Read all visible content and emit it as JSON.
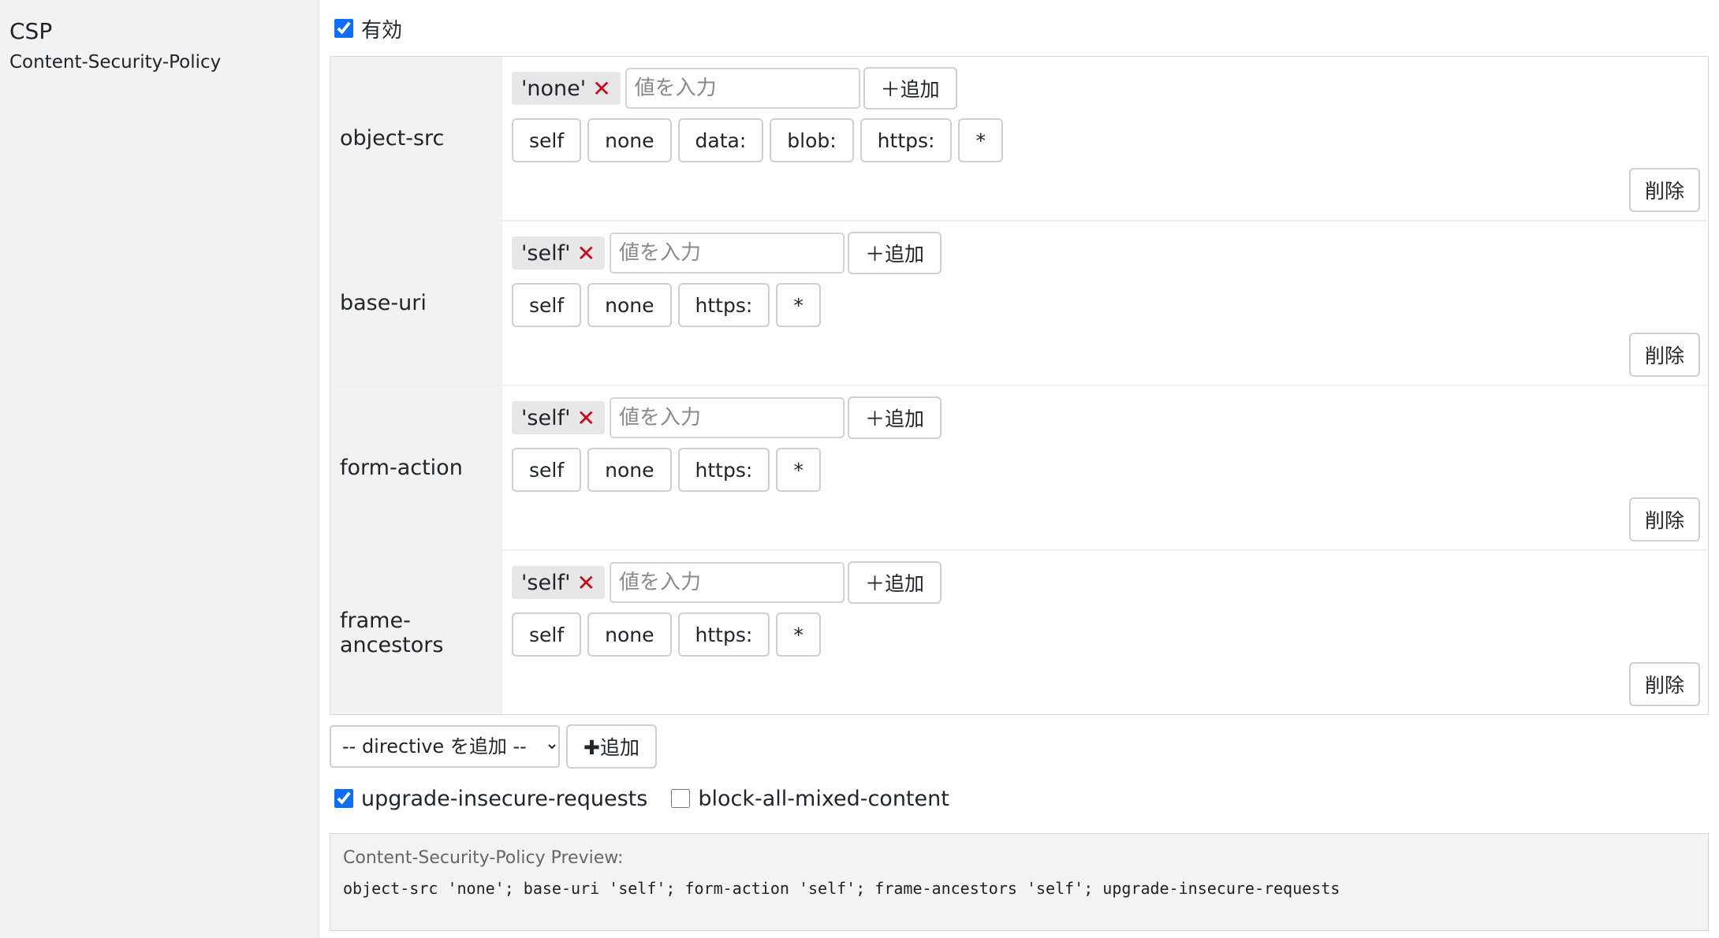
{
  "section": {
    "title": "CSP",
    "subtitle": "Content-Security-Policy"
  },
  "enabled": {
    "label": "有効",
    "checked": true
  },
  "input_placeholder": "値を入力",
  "add_label": "＋追加",
  "delete_label": "削除",
  "directives": [
    {
      "name": "object-src",
      "chip": "'none'",
      "presets": [
        "self",
        "none",
        "data:",
        "blob:",
        "https:",
        "*"
      ]
    },
    {
      "name": "base-uri",
      "chip": "'self'",
      "presets": [
        "self",
        "none",
        "https:",
        "*"
      ]
    },
    {
      "name": "form-action",
      "chip": "'self'",
      "presets": [
        "self",
        "none",
        "https:",
        "*"
      ]
    },
    {
      "name": "frame-ancestors",
      "chip": "'self'",
      "presets": [
        "self",
        "none",
        "https:",
        "*"
      ]
    }
  ],
  "directive_select": {
    "selected": "-- directive を追加 --"
  },
  "big_add_label": "✚追加",
  "flags": [
    {
      "label": "upgrade-insecure-requests",
      "checked": true
    },
    {
      "label": "block-all-mixed-content",
      "checked": false
    }
  ],
  "preview": {
    "label": "Content-Security-Policy Preview:",
    "value": "object-src 'none'; base-uri 'self'; form-action 'self'; frame-ancestors 'self'; upgrade-insecure-requests"
  },
  "colors": {
    "accent": "#0d6efd",
    "chip_remove": "#d0021b",
    "panel_bg": "#f2f2f2"
  }
}
